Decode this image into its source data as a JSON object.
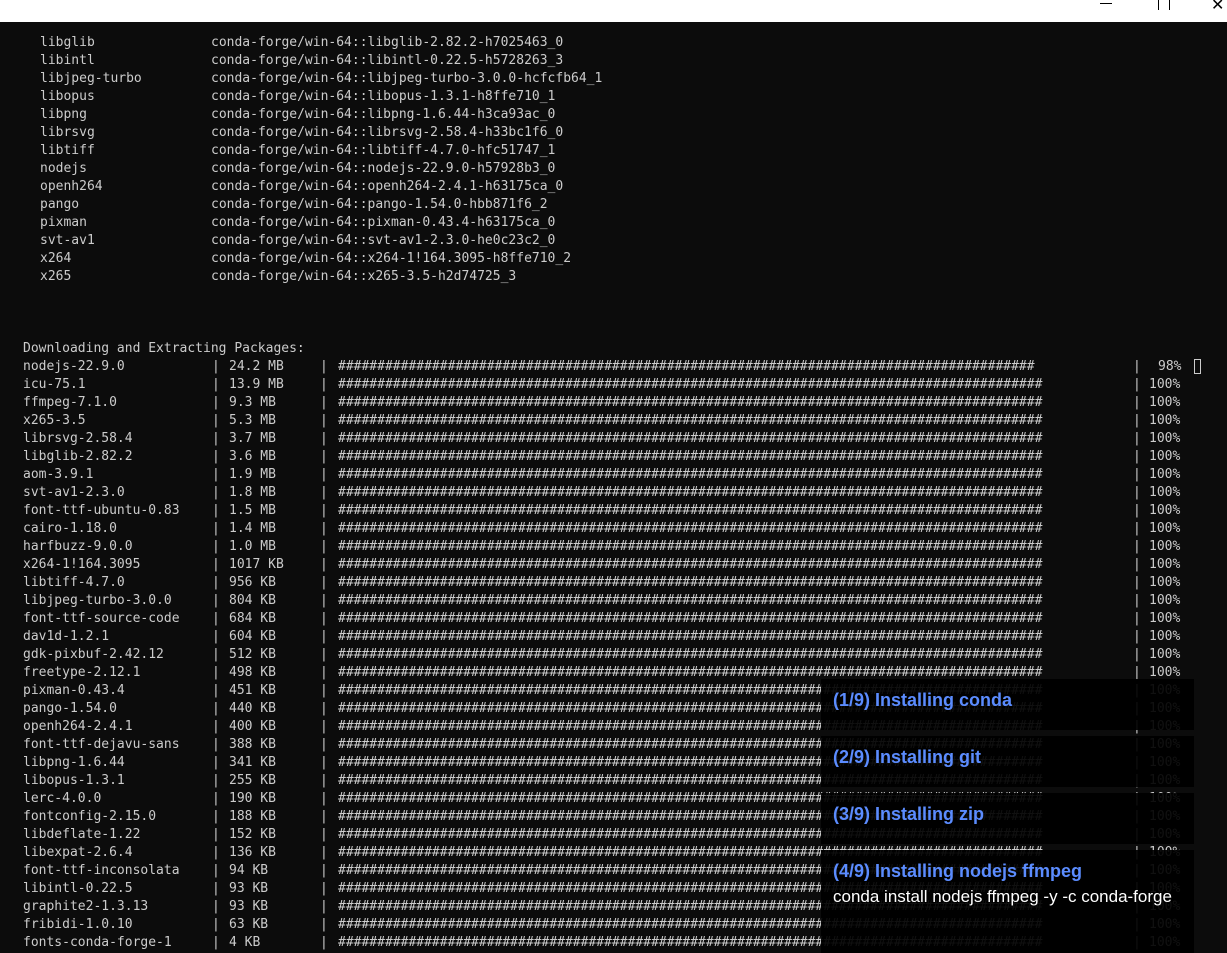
{
  "window": {
    "minimize_icon": "minimize-icon",
    "maximize_icon": "maximize-icon",
    "close_icon": "close-icon",
    "close_glyph": "✕"
  },
  "package_plan": [
    {
      "name": "libglib",
      "spec": "conda-forge/win-64::libglib-2.82.2-h7025463_0"
    },
    {
      "name": "libintl",
      "spec": "conda-forge/win-64::libintl-0.22.5-h5728263_3"
    },
    {
      "name": "libjpeg-turbo",
      "spec": "conda-forge/win-64::libjpeg-turbo-3.0.0-hcfcfb64_1"
    },
    {
      "name": "libopus",
      "spec": "conda-forge/win-64::libopus-1.3.1-h8ffe710_1"
    },
    {
      "name": "libpng",
      "spec": "conda-forge/win-64::libpng-1.6.44-h3ca93ac_0"
    },
    {
      "name": "librsvg",
      "spec": "conda-forge/win-64::librsvg-2.58.4-h33bc1f6_0"
    },
    {
      "name": "libtiff",
      "spec": "conda-forge/win-64::libtiff-4.7.0-hfc51747_1"
    },
    {
      "name": "nodejs",
      "spec": "conda-forge/win-64::nodejs-22.9.0-h57928b3_0"
    },
    {
      "name": "openh264",
      "spec": "conda-forge/win-64::openh264-2.4.1-h63175ca_0"
    },
    {
      "name": "pango",
      "spec": "conda-forge/win-64::pango-1.54.0-hbb871f6_2"
    },
    {
      "name": "pixman",
      "spec": "conda-forge/win-64::pixman-0.43.4-h63175ca_0"
    },
    {
      "name": "svt-av1",
      "spec": "conda-forge/win-64::svt-av1-2.3.0-he0c23c2_0"
    },
    {
      "name": "x264",
      "spec": "conda-forge/win-64::x264-1!164.3095-h8ffe710_2"
    },
    {
      "name": "x265",
      "spec": "conda-forge/win-64::x265-3.5-h2d74725_3"
    }
  ],
  "download_heading": "Downloading and Extracting Packages:",
  "bar_full": "##########################################################################################",
  "bar_partial": "#########################################################################################",
  "downloads": [
    {
      "name": "nodejs-22.9.0",
      "size": "24.2 MB",
      "percent": "98%",
      "fraction": 0.98
    },
    {
      "name": "icu-75.1",
      "size": "13.9 MB",
      "percent": "100%",
      "fraction": 1
    },
    {
      "name": "ffmpeg-7.1.0",
      "size": "9.3 MB",
      "percent": "100%",
      "fraction": 1
    },
    {
      "name": "x265-3.5",
      "size": "5.3 MB",
      "percent": "100%",
      "fraction": 1
    },
    {
      "name": "librsvg-2.58.4",
      "size": "3.7 MB",
      "percent": "100%",
      "fraction": 1
    },
    {
      "name": "libglib-2.82.2",
      "size": "3.6 MB",
      "percent": "100%",
      "fraction": 1
    },
    {
      "name": "aom-3.9.1",
      "size": "1.9 MB",
      "percent": "100%",
      "fraction": 1
    },
    {
      "name": "svt-av1-2.3.0",
      "size": "1.8 MB",
      "percent": "100%",
      "fraction": 1
    },
    {
      "name": "font-ttf-ubuntu-0.83",
      "size": "1.5 MB",
      "percent": "100%",
      "fraction": 1
    },
    {
      "name": "cairo-1.18.0",
      "size": "1.4 MB",
      "percent": "100%",
      "fraction": 1
    },
    {
      "name": "harfbuzz-9.0.0",
      "size": "1.0 MB",
      "percent": "100%",
      "fraction": 1
    },
    {
      "name": "x264-1!164.3095",
      "size": "1017 KB",
      "percent": "100%",
      "fraction": 1
    },
    {
      "name": "libtiff-4.7.0",
      "size": "956 KB",
      "percent": "100%",
      "fraction": 1
    },
    {
      "name": "libjpeg-turbo-3.0.0",
      "size": "804 KB",
      "percent": "100%",
      "fraction": 1
    },
    {
      "name": "font-ttf-source-code",
      "size": "684 KB",
      "percent": "100%",
      "fraction": 1
    },
    {
      "name": "dav1d-1.2.1",
      "size": "604 KB",
      "percent": "100%",
      "fraction": 1
    },
    {
      "name": "gdk-pixbuf-2.42.12",
      "size": "512 KB",
      "percent": "100%",
      "fraction": 1
    },
    {
      "name": "freetype-2.12.1",
      "size": "498 KB",
      "percent": "100%",
      "fraction": 1
    },
    {
      "name": "pixman-0.43.4",
      "size": "451 KB",
      "percent": "100%",
      "fraction": 1
    },
    {
      "name": "pango-1.54.0",
      "size": "440 KB",
      "percent": "100%",
      "fraction": 1
    },
    {
      "name": "openh264-2.4.1",
      "size": "400 KB",
      "percent": "100%",
      "fraction": 1
    },
    {
      "name": "font-ttf-dejavu-sans",
      "size": "388 KB",
      "percent": "100%",
      "fraction": 1
    },
    {
      "name": "libpng-1.6.44",
      "size": "341 KB",
      "percent": "100%",
      "fraction": 1
    },
    {
      "name": "libopus-1.3.1",
      "size": "255 KB",
      "percent": "100%",
      "fraction": 1
    },
    {
      "name": "lerc-4.0.0",
      "size": "190 KB",
      "percent": "100%",
      "fraction": 1
    },
    {
      "name": "fontconfig-2.15.0",
      "size": "188 KB",
      "percent": "100%",
      "fraction": 1
    },
    {
      "name": "libdeflate-1.22",
      "size": "152 KB",
      "percent": "100%",
      "fraction": 1
    },
    {
      "name": "libexpat-2.6.4",
      "size": "136 KB",
      "percent": "100%",
      "fraction": 1
    },
    {
      "name": "font-ttf-inconsolata",
      "size": "94 KB",
      "percent": "100%",
      "fraction": 1
    },
    {
      "name": "libintl-0.22.5",
      "size": "93 KB",
      "percent": "100%",
      "fraction": 1
    },
    {
      "name": "graphite2-1.3.13",
      "size": "93 KB",
      "percent": "100%",
      "fraction": 1
    },
    {
      "name": "fribidi-1.0.10",
      "size": "63 KB",
      "percent": "100%",
      "fraction": 1
    },
    {
      "name": "fonts-conda-forge-1",
      "size": "4 KB",
      "percent": "100%",
      "fraction": 1
    }
  ],
  "notifications": [
    {
      "title": "(1/9) Installing conda",
      "command": ""
    },
    {
      "title": "(2/9) Installing git",
      "command": ""
    },
    {
      "title": "(3/9) Installing zip",
      "command": ""
    },
    {
      "title": "(4/9) Installing nodejs ffmpeg",
      "command": "conda install nodejs ffmpeg -y -c conda-forge"
    }
  ]
}
